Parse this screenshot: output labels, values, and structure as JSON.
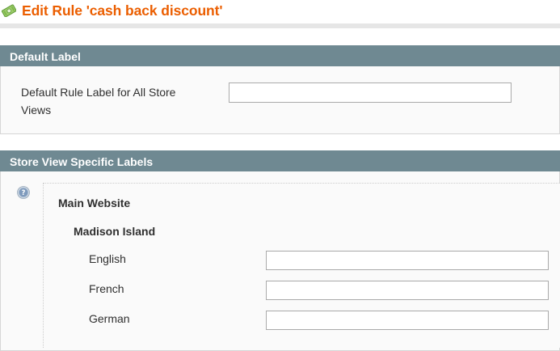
{
  "page": {
    "title": "Edit Rule 'cash back discount'",
    "icon": "rule-discount-icon",
    "accent_color": "#eb5e00"
  },
  "default_label_section": {
    "heading": "Default Label",
    "field_label": "Default Rule Label for All Store Views",
    "field_value": ""
  },
  "store_labels_section": {
    "heading": "Store View Specific Labels",
    "help_icon": "help-icon",
    "website": "Main Website",
    "store": "Madison Island",
    "store_views": [
      {
        "label": "English",
        "value": ""
      },
      {
        "label": "French",
        "value": ""
      },
      {
        "label": "German",
        "value": ""
      }
    ]
  },
  "colors": {
    "section_header_bg": "#6f8992",
    "section_header_text": "#ffffff",
    "panel_bg": "#fafafa"
  }
}
